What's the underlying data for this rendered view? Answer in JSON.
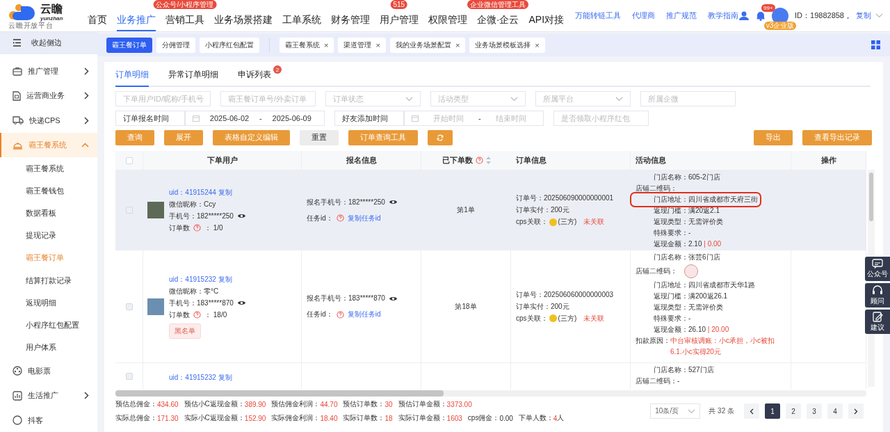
{
  "header": {
    "logo": {
      "name": "云瞻",
      "latin": "yunzhan",
      "tagline": "云 瞻 开 放 平 台"
    },
    "nav": [
      {
        "label": "首页",
        "selected": false
      },
      {
        "label": "业务推广",
        "selected": true
      },
      {
        "label": "营销工具",
        "selected": false,
        "badge": "公众号/小程序管理"
      },
      {
        "label": "业务场景搭建",
        "selected": false
      },
      {
        "label": "工单系统",
        "selected": false
      },
      {
        "label": "财务管理",
        "selected": false
      },
      {
        "label": "用户管理",
        "selected": false,
        "badge": "515"
      },
      {
        "label": "权限管理",
        "selected": false
      },
      {
        "label": "企微·企云",
        "selected": false,
        "badge": "企业微信管理工具"
      },
      {
        "label": "API对接",
        "selected": false
      }
    ],
    "links": [
      "万能转链工具",
      "代理商",
      "推广规范",
      "教学指南"
    ],
    "notifications": "99+",
    "plan": "v3企业版",
    "account_id": "ID：19882858，",
    "copy": "复制"
  },
  "sidebar": {
    "collapse": "收起侧边",
    "items": [
      {
        "label": "推广管理",
        "kind": "group",
        "expanded": false,
        "selected": false
      },
      {
        "label": "运营商业务",
        "kind": "group",
        "expanded": false,
        "selected": false
      },
      {
        "label": "快递CPS",
        "kind": "group",
        "expanded": false,
        "selected": false
      },
      {
        "label": "霸王餐系统",
        "kind": "group",
        "expanded": true,
        "selected": true,
        "children": [
          {
            "label": "霸王餐系统",
            "selected": false
          },
          {
            "label": "霸王餐钱包",
            "selected": false
          },
          {
            "label": "数据看板",
            "selected": false
          },
          {
            "label": "提现记录",
            "selected": false
          },
          {
            "label": "霸王餐订单",
            "selected": true
          },
          {
            "label": "结算打款记录",
            "selected": false
          },
          {
            "label": "返现明细",
            "selected": false
          },
          {
            "label": "小程序红包配置",
            "selected": false
          },
          {
            "label": "用户体系",
            "selected": false
          }
        ]
      },
      {
        "label": "电影票",
        "kind": "link",
        "selected": false
      },
      {
        "label": "生活推广",
        "kind": "group",
        "expanded": false,
        "selected": false
      },
      {
        "label": "抖客",
        "kind": "link",
        "selected": false
      }
    ]
  },
  "tag_bar": {
    "pinned": [
      {
        "label": "霸王餐订单",
        "selected": true
      },
      {
        "label": "分佣管理",
        "selected": false
      },
      {
        "label": "小程序红包配置",
        "selected": false
      }
    ],
    "recent": [
      {
        "label": "霸王餐系统",
        "close": "×"
      },
      {
        "label": "渠道管理",
        "close": "×"
      },
      {
        "label": "我的业务场景配置",
        "close": "×"
      },
      {
        "label": "业务场景模板选择",
        "close": "×"
      }
    ]
  },
  "tabs": [
    {
      "label": "订单明细",
      "selected": true
    },
    {
      "label": "异常订单明细",
      "selected": false
    },
    {
      "label": "申诉列表",
      "selected": false,
      "badge": "2"
    }
  ],
  "filters": [
    [
      [
        {
          "kind": "input",
          "placeholder": "下单用户ID/昵称/手机号"
        }
      ],
      [
        {
          "kind": "input",
          "placeholder": "霸王餐订单号/外卖订单"
        }
      ],
      [
        {
          "kind": "select",
          "placeholder": "订单状态"
        }
      ],
      [
        {
          "kind": "select",
          "placeholder": "活动类型"
        }
      ],
      [
        {
          "kind": "select",
          "placeholder": "所属平台"
        }
      ],
      [
        {
          "kind": "input",
          "placeholder": "所属企微"
        }
      ]
    ],
    [
      [
        {
          "kind": "select",
          "value": "订单报名时间"
        },
        {
          "kind": "daterange",
          "start": "2025-06-02",
          "separator": "-",
          "end": "2025-06-09"
        }
      ],
      [
        {
          "kind": "select",
          "value": "好友添加时间"
        },
        {
          "kind": "daterange",
          "start_placeholder": "开始时间",
          "separator": "-",
          "end_placeholder": "结束时间"
        }
      ],
      [
        {
          "kind": "input",
          "placeholder": "是否领取小程序红包"
        }
      ]
    ]
  ],
  "actions": [
    {
      "kind": "primary",
      "label": "查询"
    },
    {
      "kind": "primary",
      "label": "展开"
    },
    {
      "kind": "primary",
      "label": "表格自定义编辑"
    },
    {
      "kind": "default",
      "label": "重置"
    },
    {
      "kind": "primary",
      "label": "订单查询工具"
    },
    {
      "kind": "refresh"
    }
  ],
  "export_actions": [
    "导出",
    "查看导出记录"
  ],
  "table": {
    "all_checked": false,
    "columns": [
      {
        "label": "下单用户"
      },
      {
        "label": "报名信息"
      },
      {
        "label": "已下单数",
        "help": true,
        "sortable": true
      },
      {
        "label": "订单信息"
      },
      {
        "label": "活动信息"
      },
      {
        "label": "操作"
      }
    ],
    "rows": [
      {
        "checked": false,
        "hovered": true,
        "user": {
          "uid": "uid：41915244 复制",
          "nickname": "微信昵称：Ccy",
          "phone": "手机号：182*****250",
          "orders_label": "订单数",
          "orders": "：  1/0"
        },
        "signup": {
          "phone": "报名手机号：182*****250",
          "task_label": "任务id：",
          "task_link": "复制任务id"
        },
        "order_count": "第1单",
        "order": {
          "number": "订单号：202506090000000001",
          "paid": "订单实付：200元",
          "cps_label": "cps关联：",
          "cps_source": "(三方)",
          "cps_status": "未关联"
        },
        "activity": [
          {
            "kind": "text",
            "label": "门店名称：",
            "value": "605-2门店",
            "highlighted": false
          },
          {
            "kind": "text",
            "label": "店铺二维码：",
            "highlighted": false
          },
          {
            "kind": "text",
            "label": "门店地址：",
            "value": "四川省成都市天府三街",
            "highlighted": true
          },
          {
            "kind": "text",
            "label": "返现门槛：",
            "value": "满20返2.1",
            "highlighted": false
          },
          {
            "kind": "text",
            "label": "返现类型：",
            "value": "无需评价类",
            "highlighted": false
          },
          {
            "kind": "text",
            "label": "特殊要求：",
            "value": "-",
            "highlighted": false
          },
          {
            "kind": "amount",
            "label": "返现金额：",
            "value": "2.10",
            "extra": "| 0.00",
            "highlighted": false
          }
        ]
      },
      {
        "checked": false,
        "hovered": false,
        "user": {
          "uid": "uid：41915232 复制",
          "nickname": "微信昵称：零°C",
          "phone": "手机号：183*****870",
          "orders_label": "订单数",
          "orders": "：  18/0",
          "tag": "黑名单"
        },
        "signup": {
          "phone": "报名手机号：183*****870",
          "task_label": "任务id：",
          "task_link": "复制任务id"
        },
        "order_count": "第18单",
        "order": {
          "number": "订单号：202506060000000003",
          "paid": "订单实付：200元",
          "cps_label": "cps关联：",
          "cps_source": "(三方)",
          "cps_status": "未关联"
        },
        "activity": [
          {
            "kind": "text",
            "label": "门店名称：",
            "value": "张芸6门店",
            "highlighted": false
          },
          {
            "kind": "qr",
            "label": "店铺二维码：",
            "highlighted": false
          },
          {
            "kind": "text",
            "label": "门店地址：",
            "value": "四川省成都市天华1路",
            "highlighted": false
          },
          {
            "kind": "text",
            "label": "返现门槛：",
            "value": "满200返26.1",
            "highlighted": false
          },
          {
            "kind": "text",
            "label": "返现类型：",
            "value": "无需评价类",
            "highlighted": false
          },
          {
            "kind": "text",
            "label": "特殊要求：",
            "value": "-",
            "highlighted": false
          },
          {
            "kind": "amount",
            "label": "返现金额：",
            "value": "26.10",
            "extra": "| 20.00",
            "highlighted": false
          },
          {
            "kind": "reason",
            "label": "扣款原因：",
            "value": "中台审核调账：小c承担，小c被扣6.1.小c实得20元",
            "highlighted": false
          }
        ]
      },
      {
        "checked": false,
        "hovered": false,
        "partial": true,
        "user": {
          "uid": "uid：41915232 复制"
        },
        "activity": [
          {
            "kind": "text",
            "label": "门店名称：",
            "value": "527门店",
            "highlighted": false
          },
          {
            "kind": "text",
            "label": "店铺二维码：",
            "value": "-",
            "highlighted": false
          }
        ]
      }
    ]
  },
  "summary": [
    [
      {
        "label": "预估总佣金：",
        "value": "434.60",
        "emphasis": true
      },
      {
        "label": "预估小C返现金额：",
        "value": "389.90",
        "emphasis": true
      },
      {
        "label": "预估佣金利润：",
        "value": "44.70",
        "emphasis": true
      },
      {
        "label": "预估订单数：",
        "value": "30",
        "emphasis": true
      },
      {
        "label": "预估订单金额：",
        "value": "3373.00",
        "emphasis": true
      }
    ],
    [
      {
        "label": "实际总佣金：",
        "value": "171.30",
        "emphasis": true
      },
      {
        "label": "实际小C返现金额：",
        "value": "152.90",
        "emphasis": true
      },
      {
        "label": "实际佣金利润：",
        "value": "18.40",
        "emphasis": true
      },
      {
        "label": "实际订单数：",
        "value": "18",
        "emphasis": true
      },
      {
        "label": "实际订单金额：",
        "value": "1603",
        "emphasis": true
      },
      {
        "label": "cps佣金：",
        "value": "0.00",
        "emphasis": false
      },
      {
        "label": "下单人数：",
        "value": "4",
        "unit": "人",
        "emphasis": true
      }
    ]
  ],
  "pagination": {
    "page_size": "10条/页",
    "total": "共 32 条",
    "pages": [
      {
        "label": "1",
        "selected": true
      },
      {
        "label": "2",
        "selected": false
      },
      {
        "label": "3",
        "selected": false
      },
      {
        "label": "4",
        "selected": false
      }
    ]
  },
  "float_buttons": [
    {
      "label": "公众号"
    },
    {
      "label": "顾问"
    },
    {
      "label": "建议"
    }
  ]
}
